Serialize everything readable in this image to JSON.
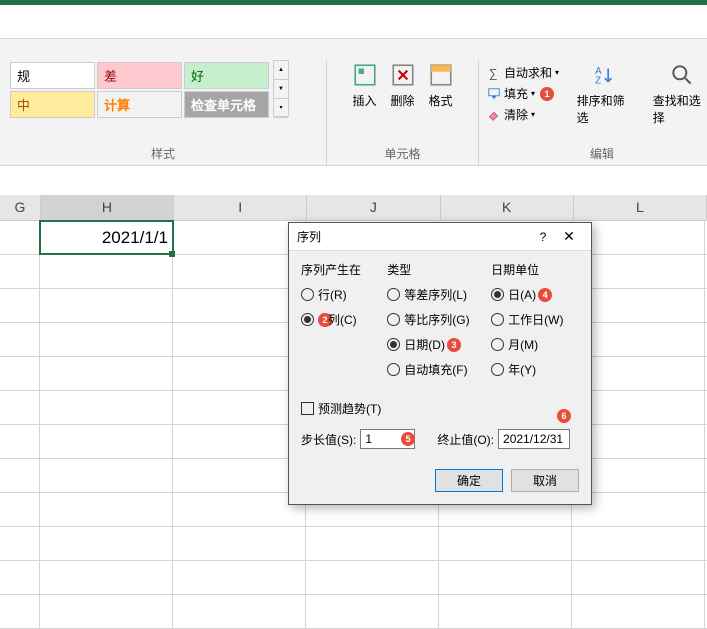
{
  "ribbon": {
    "styles": {
      "normal": "规",
      "bad": "差",
      "good": "好",
      "neutral": "中",
      "calc": "计算",
      "check": "检查单元格",
      "group_label": "样式"
    },
    "cells": {
      "insert": "插入",
      "delete": "删除",
      "format": "格式",
      "group_label": "单元格"
    },
    "editing": {
      "autosum": "自动求和",
      "fill": "填充",
      "clear": "清除",
      "sort": "排序和筛选",
      "find": "查找和选择",
      "group_label": "编辑"
    }
  },
  "markers": {
    "m1": "1",
    "m2": "2",
    "m3": "3",
    "m4": "4",
    "m5": "5",
    "m6": "6"
  },
  "grid": {
    "columns": [
      "G",
      "H",
      "I",
      "J",
      "K",
      "L"
    ],
    "active_value": "2021/1/1"
  },
  "dialog": {
    "title": "序列",
    "section_where": "序列产生在",
    "where_row": "行(R)",
    "where_col": "列(C)",
    "section_type": "类型",
    "type_arith": "等差序列(L)",
    "type_geom": "等比序列(G)",
    "type_date": "日期(D)",
    "type_autofill": "自动填充(F)",
    "section_dateunit": "日期单位",
    "unit_day": "日(A)",
    "unit_workday": "工作日(W)",
    "unit_month": "月(M)",
    "unit_year": "年(Y)",
    "trend": "预测趋势(T)",
    "step_label": "步长值(S):",
    "step_value": "1",
    "stop_label": "终止值(O):",
    "stop_value": "2021/12/31",
    "ok": "确定",
    "cancel": "取消"
  }
}
